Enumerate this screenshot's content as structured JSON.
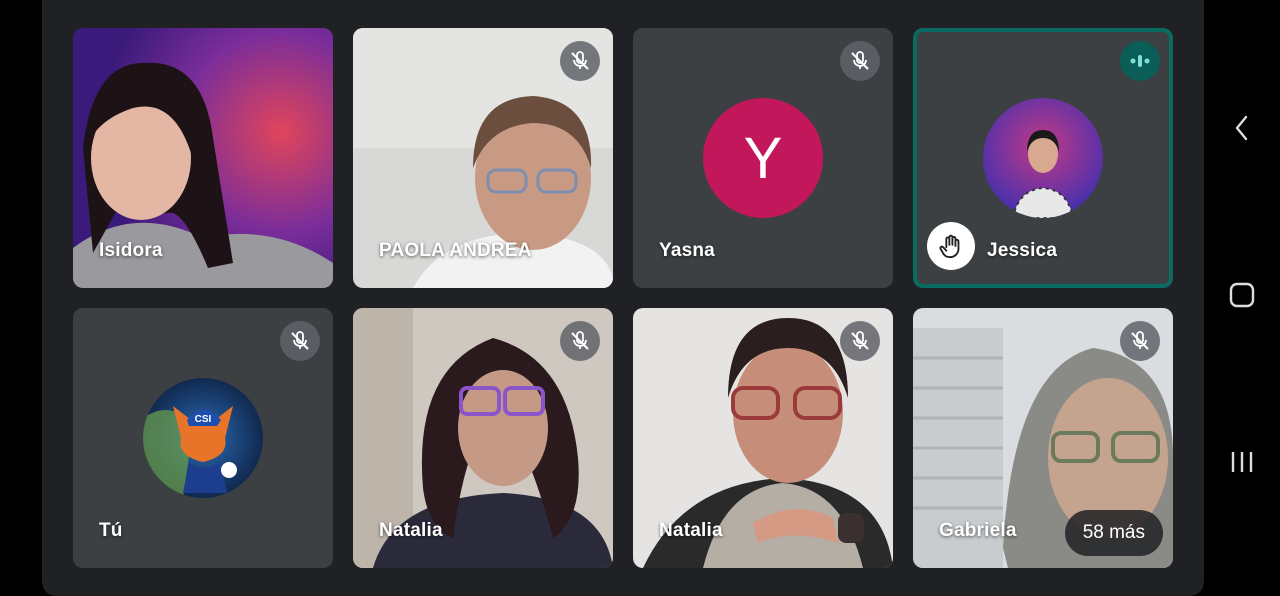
{
  "participants": [
    {
      "name": "Isidora",
      "muted": false,
      "kind": "video"
    },
    {
      "name": "PAOLA ANDREA",
      "muted": true,
      "kind": "video"
    },
    {
      "name": "Yasna",
      "muted": true,
      "kind": "letter",
      "initial": "Y",
      "avatar_color": "#c2185b"
    },
    {
      "name": "Jessica",
      "muted": false,
      "kind": "photo",
      "speaking": true,
      "hand_raised": true
    },
    {
      "name": "Tú",
      "muted": true,
      "kind": "photo"
    },
    {
      "name": "Natalia",
      "muted": true,
      "kind": "video"
    },
    {
      "name": "Natalia",
      "muted": true,
      "kind": "video"
    },
    {
      "name": "Gabriela",
      "muted": true,
      "kind": "video"
    }
  ],
  "overflow": {
    "label": "58 más"
  },
  "colors": {
    "background": "#202124",
    "speaking_accent": "#0a6b63",
    "tile": "#3c4043"
  },
  "icons": {
    "muted": "mic-off-icon",
    "speaking": "audio-wave-icon",
    "hand": "raised-hand-icon",
    "back": "back-chevron-icon",
    "home": "home-icon",
    "recents": "recents-icon"
  }
}
